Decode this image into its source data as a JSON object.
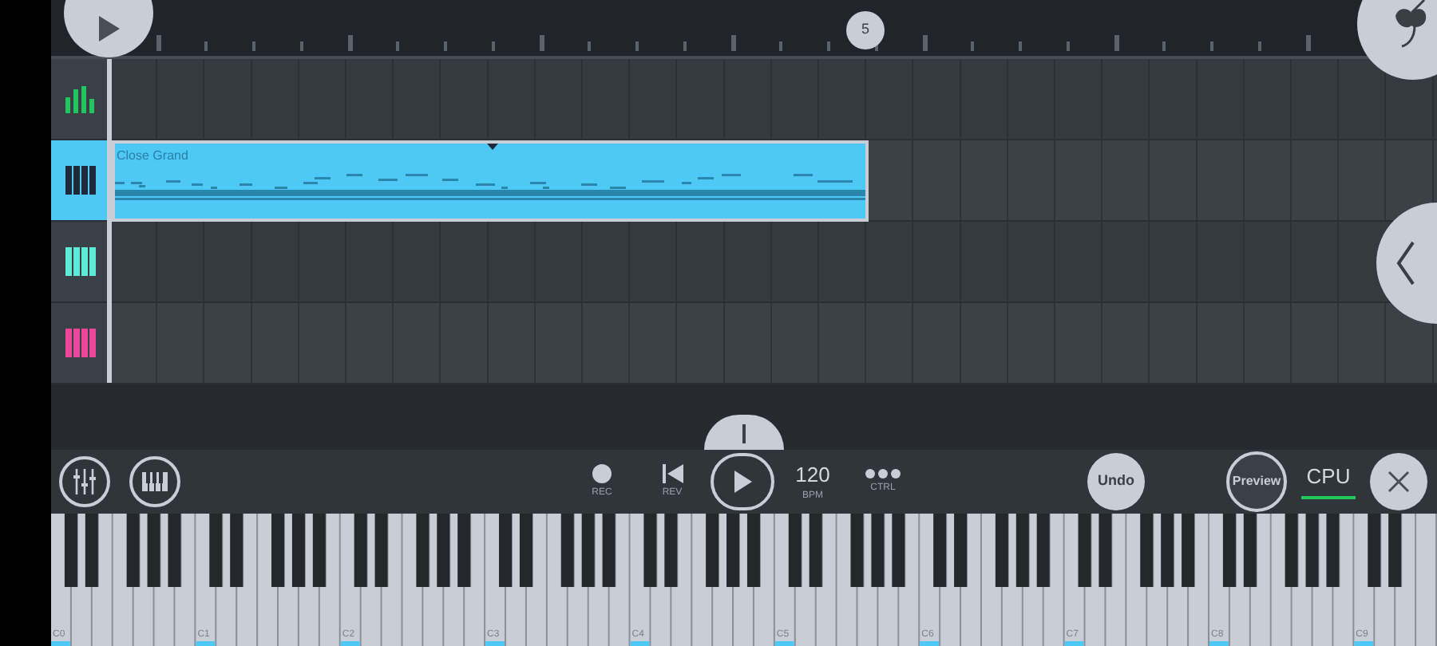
{
  "ruler": {
    "marker": "5"
  },
  "tracks": [
    {
      "kind": "meter",
      "selected": false,
      "color": "#22c55e"
    },
    {
      "kind": "keys",
      "selected": true,
      "color": "#1f2937"
    },
    {
      "kind": "keys",
      "selected": false,
      "color": "#5eead4"
    },
    {
      "kind": "keys",
      "selected": false,
      "color": "#ec4899"
    }
  ],
  "pattern": {
    "name": "Close Grand"
  },
  "toolbar": {
    "transport": [
      {
        "kind": "rec",
        "label": "REC"
      },
      {
        "kind": "rev",
        "label": "REV"
      },
      {
        "kind": "play"
      },
      {
        "kind": "bpm",
        "value": "120",
        "label": "BPM"
      },
      {
        "kind": "ctrl",
        "label": "CTRL"
      }
    ],
    "undo": "Undo",
    "preview": "Preview",
    "cpu": "CPU"
  },
  "keyboard": {
    "octave_labels": [
      "C0",
      "C1",
      "C2",
      "C3",
      "C4",
      "C5",
      "C6",
      "C7",
      "C8",
      "C9"
    ]
  }
}
